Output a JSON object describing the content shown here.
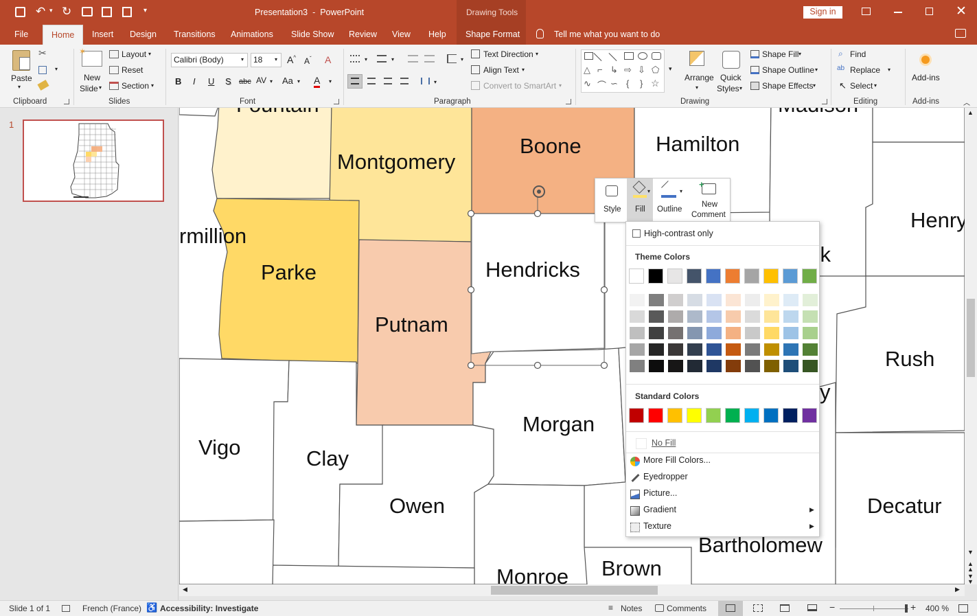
{
  "title_bar": {
    "document_title": "Presentation3  -  PowerPoint",
    "context_label": "Drawing Tools",
    "sign_in": "Sign in"
  },
  "tabs": [
    "File",
    "Home",
    "Insert",
    "Design",
    "Transitions",
    "Animations",
    "Slide Show",
    "Review",
    "View",
    "Help",
    "Shape Format"
  ],
  "tell_me": "Tell me what you want to do",
  "ribbon": {
    "clipboard": {
      "paste": "Paste",
      "group": "Clipboard"
    },
    "slides": {
      "new_slide_1": "New",
      "new_slide_2": "Slide",
      "layout": "Layout",
      "reset": "Reset",
      "section": "Section",
      "group": "Slides"
    },
    "font": {
      "font_name": "Calibri (Body)",
      "font_size": "18",
      "group": "Font"
    },
    "paragraph": {
      "text_direction": "Text Direction",
      "align_text": "Align Text",
      "convert_smartart": "Convert to SmartArt",
      "group": "Paragraph"
    },
    "drawing": {
      "arrange": "Arrange",
      "quick_styles_1": "Quick",
      "quick_styles_2": "Styles",
      "shape_fill": "Shape Fill",
      "shape_outline": "Shape Outline",
      "shape_effects": "Shape Effects",
      "group": "Drawing"
    },
    "editing": {
      "find": "Find",
      "replace": "Replace",
      "select": "Select",
      "group": "Editing"
    },
    "addins": {
      "label": "Add-ins",
      "group": "Add-ins"
    }
  },
  "slide_panel": {
    "slide_number": "1"
  },
  "counties": {
    "fountain": "Fountain",
    "montgomery": "Montgomery",
    "boone": "Boone",
    "hamilton": "Hamilton",
    "madison": "Madison",
    "henry": "Henry",
    "vermillion": "rmillion",
    "parke": "Parke",
    "hendricks": "Hendricks",
    "hancock_fragment": "ck",
    "putnam": "Putnam",
    "rush": "Rush",
    "shelby_fragment": "y",
    "vigo": "Vigo",
    "clay": "Clay",
    "morgan": "Morgan",
    "owen": "Owen",
    "decatur": "Decatur",
    "bartholomew": "Bartholomew",
    "monroe": "Monroe",
    "brown": "Brown"
  },
  "mini_toolbar": {
    "style": "Style",
    "fill": "Fill",
    "outline": "Outline",
    "new_comment_1": "New",
    "new_comment_2": "Comment"
  },
  "fill_menu": {
    "high_contrast": "High-contrast only",
    "theme_colors": "Theme Colors",
    "standard_colors": "Standard Colors",
    "no_fill": "No Fill",
    "more_colors": "More Fill Colors...",
    "eyedropper": "Eyedropper",
    "picture": "Picture...",
    "gradient": "Gradient",
    "texture": "Texture",
    "theme_base": [
      "#ffffff",
      "#000000",
      "#e7e6e6",
      "#44546a",
      "#4472c4",
      "#ed7d31",
      "#a5a5a5",
      "#ffc000",
      "#5b9bd5",
      "#70ad47"
    ],
    "theme_shades": [
      [
        "#f2f2f2",
        "#d9d9d9",
        "#bfbfbf",
        "#a6a6a6",
        "#808080"
      ],
      [
        "#7f7f7f",
        "#595959",
        "#404040",
        "#262626",
        "#0d0d0d"
      ],
      [
        "#d0cece",
        "#aeabab",
        "#757171",
        "#3b3838",
        "#171616"
      ],
      [
        "#d6dce4",
        "#adb9ca",
        "#8496b0",
        "#333f4f",
        "#222a35"
      ],
      [
        "#d9e2f3",
        "#b4c6e7",
        "#8eaadb",
        "#2f5496",
        "#1f3864"
      ],
      [
        "#fbe5d5",
        "#f7cbac",
        "#f4b183",
        "#c55a11",
        "#833c0b"
      ],
      [
        "#ededed",
        "#dbdbdb",
        "#c9c9c9",
        "#7b7b7b",
        "#525252"
      ],
      [
        "#fff2cc",
        "#fee599",
        "#ffd965",
        "#bf8f00",
        "#7f6000"
      ],
      [
        "#deebf6",
        "#bdd7ee",
        "#9dc3e6",
        "#2e75b5",
        "#1e4e79"
      ],
      [
        "#e2efd9",
        "#c5e0b3",
        "#a8d08d",
        "#538135",
        "#375623"
      ]
    ],
    "standard": [
      "#c00000",
      "#ff0000",
      "#ffc000",
      "#ffff00",
      "#92d050",
      "#00b050",
      "#00b0f0",
      "#0070c0",
      "#002060",
      "#7030a0"
    ]
  },
  "status_bar": {
    "slide_info": "Slide 1 of 1",
    "language": "French (France)",
    "accessibility": "Accessibility: Investigate",
    "notes": "Notes",
    "comments": "Comments",
    "zoom": "400 %"
  },
  "colors": {
    "accent": "#b7472a",
    "selected_fill_highlight": "#d6d6d6"
  }
}
